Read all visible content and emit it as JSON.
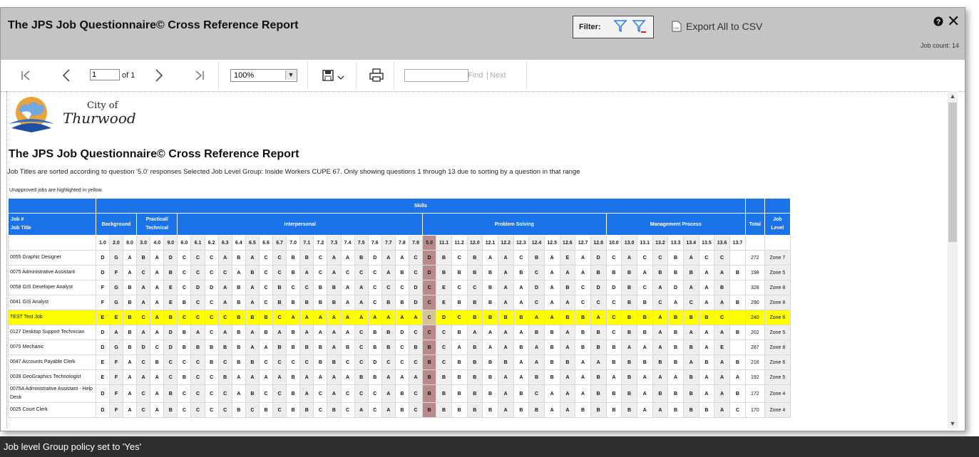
{
  "dialog": {
    "title": "The JPS Job Questionnaire© Cross Reference Report",
    "filter_label": "Filter:",
    "export_label": "Export All to CSV",
    "job_count": "Job count: 14"
  },
  "toolbar": {
    "page_value": "1",
    "of_pages": "of 1",
    "zoom": "100%",
    "find_label": "Find",
    "separator": "|",
    "next_label": "Next"
  },
  "report": {
    "logo_city_of": "City of",
    "logo_name": "Thurwood",
    "title": "The JPS Job Questionnaire© Cross Reference Report",
    "description": "Job Titles are sorted according to question '5.0' responses Selected Job Level Group: Inside Workers CUPE 67. Only showing questions 1 through 13 due to sorting by a question in that range",
    "note": "Unapproved jobs are highlighted in yellow.",
    "headers": {
      "skills": "Skills",
      "job_num": "Job #",
      "job_title": "Job Title",
      "background": "Background",
      "practical_1": "Practical/",
      "practical_2": "Technical",
      "interpersonal": "Interpersonal",
      "problem_solving": "Problem Solving",
      "management": "Management Process",
      "total": "Total",
      "job_level_1": "Job",
      "job_level_2": "Level"
    },
    "questions": [
      "1.0",
      "2.0",
      "8.0",
      "3.0",
      "4.0",
      "9.0",
      "6.0",
      "6.1",
      "6.2",
      "6.3",
      "6.4",
      "6.5",
      "6.6",
      "6.7",
      "7.0",
      "7.1",
      "7.2",
      "7.3",
      "7.4",
      "7.5",
      "7.6",
      "7.7",
      "7.8",
      "7.9",
      "5.0",
      "11.1",
      "11.2",
      "12.0",
      "12.1",
      "12.2",
      "12.3",
      "12.4",
      "12.5",
      "12.6",
      "12.7",
      "12.8",
      "10.0",
      "13.0",
      "13.1",
      "13.2",
      "13.3",
      "13.4",
      "13.5",
      "13.6",
      "13.7"
    ],
    "rows": [
      {
        "title": "0055 Graphic Designer",
        "answers": "DGABADCCCABACCBBCAABDAACDBCBAACBAEADCACCBACC",
        "total": "272",
        "level": "Zone 7"
      },
      {
        "title": "0075 Administrative Assistant",
        "answers": "DFACABCCCCABCCBACACCCABCDBBBBABCAAABBBABBBAAB",
        "total": "198",
        "level": "Zone 5"
      },
      {
        "title": "0058 GIS Developer Analyst",
        "answers": "FGBAAECDDABACBCCBBAACCCDCECCBAADABCDDBCADAAB",
        "total": "328",
        "level": "Zone 8"
      },
      {
        "title": "0041 GIS Analyst",
        "answers": "FGBAAEBCCABACBBBBBAACBBDCEBBBAACAACCCBBCACAAB",
        "total": "290",
        "level": "Zone 8"
      },
      {
        "title": "TEST Test Job",
        "answers": "EEBCABCCCCBBBCAAAAAAAAAACDCBBBBAABBACBBABBBC",
        "total": "240",
        "level": "Zone 6",
        "highlight": true
      },
      {
        "title": "0127 Desktop Support Technician",
        "answers": "DABAADBACABABABAAAACBBDCCCBAAAABBABBCBBABAAAB",
        "total": "202",
        "level": "Zone 5"
      },
      {
        "title": "0070 Mechanic",
        "answers": "DGBDCDBBBBBAABBBBABCBBCBBCABAABABABBBAAABBAE",
        "total": "287",
        "level": "Zone 8"
      },
      {
        "title": "0047 Accounts Payable Clerk",
        "answers": "EFACBCCCBCBBCCCCBBCCDCCCBCBBBBAABBAABBBBBABAB",
        "total": "216",
        "level": "Zone 6"
      },
      {
        "title": "0039 GeoGraphics Technologist",
        "answers": "EFAAACBCCBAAAABAAAABBAAABBBBBAABBAABABAAABAAA",
        "total": "192",
        "level": "Zone 5"
      },
      {
        "title": "0075A Administrative Assistant - Help Desk",
        "answers": "DFACABCCCCABCCBACACCCABCBBBBBABCAAABBBABBBAAB",
        "total": "172",
        "level": "Zone 4"
      },
      {
        "title": "0025 Court Clerk",
        "answers": "DFACABCCCCBCBCBBCBCACABCBBBBBABBAABBBBAABBBAC",
        "total": "170",
        "level": "Zone 4"
      }
    ]
  },
  "status": {
    "message": "Job level Group policy set to 'Yes'"
  }
}
